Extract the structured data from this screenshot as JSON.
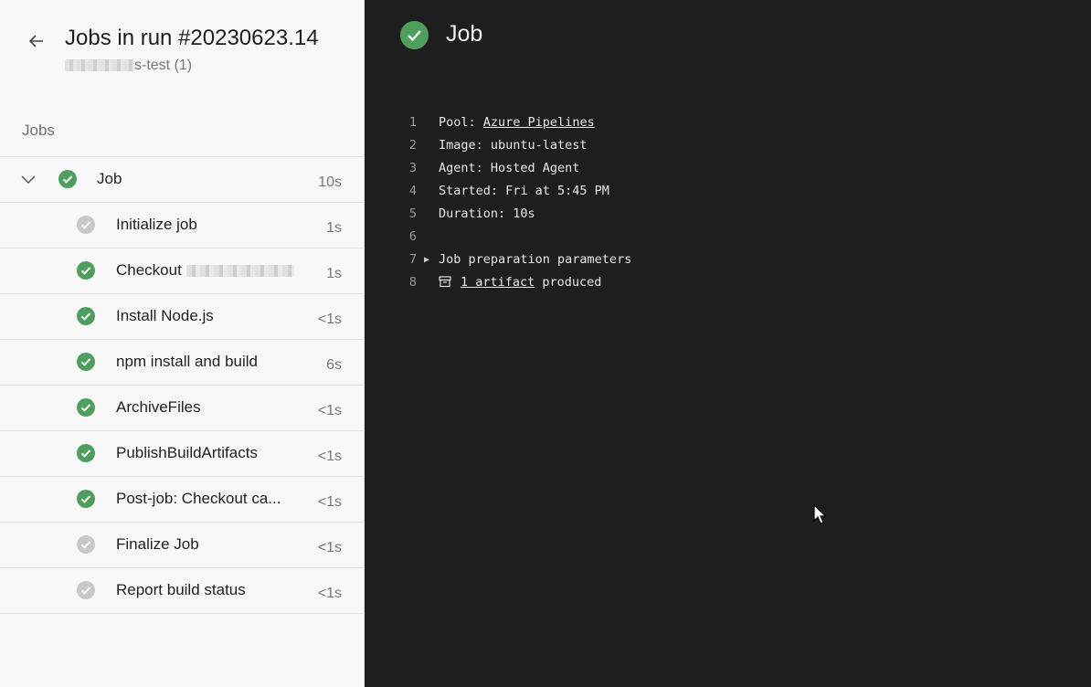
{
  "left": {
    "back_icon": "arrow-left-icon",
    "title": "Jobs in run #20230623.14",
    "subtitle_suffix": "s-test (1)",
    "jobs_heading": "Jobs",
    "job": {
      "label": "Job",
      "duration": "10s",
      "status": "success"
    },
    "steps": [
      {
        "label": "Initialize job",
        "duration": "1s",
        "status": "skipped"
      },
      {
        "label": "Checkout ",
        "duration": "1s",
        "status": "success",
        "redacted": true
      },
      {
        "label": "Install Node.js",
        "duration": "<1s",
        "status": "success"
      },
      {
        "label": "npm install and build",
        "duration": "6s",
        "status": "success"
      },
      {
        "label": "ArchiveFiles",
        "duration": "<1s",
        "status": "success"
      },
      {
        "label": "PublishBuildArtifacts",
        "duration": "<1s",
        "status": "success"
      },
      {
        "label": "Post-job: Checkout ca...",
        "duration": "<1s",
        "status": "success"
      },
      {
        "label": "Finalize Job",
        "duration": "<1s",
        "status": "skipped"
      },
      {
        "label": "Report build status",
        "duration": "<1s",
        "status": "skipped"
      }
    ]
  },
  "right": {
    "title": "Job",
    "status": "success",
    "log": [
      {
        "n": "1",
        "prefix": "Pool: ",
        "link": "Azure Pipelines",
        "suffix": ""
      },
      {
        "n": "2",
        "text": "Image: ubuntu-latest"
      },
      {
        "n": "3",
        "text": "Agent: Hosted Agent"
      },
      {
        "n": "4",
        "text": "Started: Fri at 5:45 PM"
      },
      {
        "n": "5",
        "text": "Duration: 10s"
      },
      {
        "n": "6",
        "text": ""
      },
      {
        "n": "7",
        "text": "Job preparation parameters",
        "expandable": true
      },
      {
        "n": "8",
        "link": "1 artifact",
        "suffix": " produced",
        "icon": "archive-icon"
      }
    ]
  },
  "colors": {
    "success": "#4f9e5d",
    "skipped": "#c8c8c8",
    "log_bg": "#1e1e1e",
    "panel_bg": "#f8f8f8"
  }
}
